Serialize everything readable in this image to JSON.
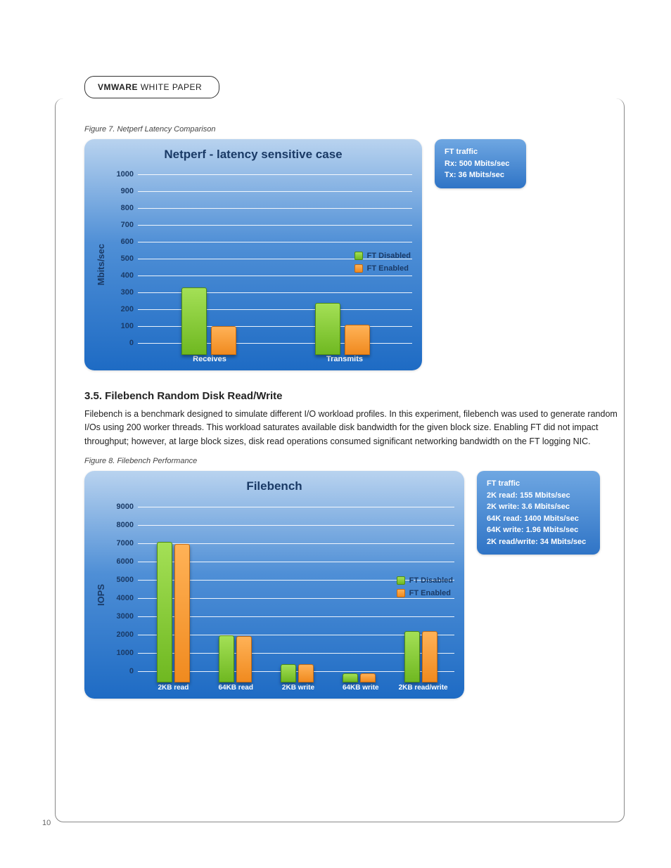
{
  "header": {
    "brand": "VMWARE",
    "doc_type": "WHITE PAPER"
  },
  "page_number": "10",
  "fig7": {
    "caption": "Figure 7. Netperf Latency Comparison",
    "info": {
      "title": "FT traffic",
      "lines": [
        "Rx: 500 Mbits/sec",
        "Tx: 36 Mbits/sec"
      ]
    }
  },
  "section": {
    "heading": "3.5. Filebench Random Disk Read/Write",
    "body": "Filebench is a benchmark designed to simulate different I/O workload profiles. In this experiment, filebench was used to generate random I/Os using 200 worker threads. This workload saturates available disk bandwidth for the given block size. Enabling FT did not impact throughput; however, at large block sizes, disk read operations consumed significant networking bandwidth on the FT logging NIC."
  },
  "fig8": {
    "caption": "Figure 8. Filebench Performance",
    "info": {
      "title": "FT traffic",
      "lines": [
        "2K read: 155 Mbits/sec",
        "2K write: 3.6 Mbits/sec",
        "64K read: 1400 Mbits/sec",
        "64K write: 1.96 Mbits/sec",
        "2K read/write: 34 Mbits/sec"
      ]
    }
  },
  "legend": {
    "a": "FT Disabled",
    "b": "FT Enabled"
  },
  "chart_data": [
    {
      "type": "bar",
      "title": "Netperf - latency sensitive case",
      "ylabel": "Mbits/sec",
      "ylim": [
        0,
        1000
      ],
      "yticks": [
        0,
        100,
        200,
        300,
        400,
        500,
        600,
        700,
        800,
        900,
        1000
      ],
      "categories": [
        "Receives",
        "Transmits"
      ],
      "series": [
        {
          "name": "FT Disabled",
          "values": [
            400,
            310
          ]
        },
        {
          "name": "FT Enabled",
          "values": [
            170,
            180
          ]
        }
      ]
    },
    {
      "type": "bar",
      "title": "Filebench",
      "ylabel": "IOPS",
      "ylim": [
        0,
        9000
      ],
      "yticks": [
        0,
        1000,
        2000,
        3000,
        4000,
        5000,
        6000,
        7000,
        8000,
        9000
      ],
      "categories": [
        "2KB read",
        "64KB read",
        "2KB write",
        "64KB write",
        "2KB read/write"
      ],
      "series": [
        {
          "name": "FT Disabled",
          "values": [
            7700,
            2600,
            1000,
            500,
            2800
          ]
        },
        {
          "name": "FT Enabled",
          "values": [
            7600,
            2550,
            1000,
            500,
            2800
          ]
        }
      ]
    }
  ]
}
